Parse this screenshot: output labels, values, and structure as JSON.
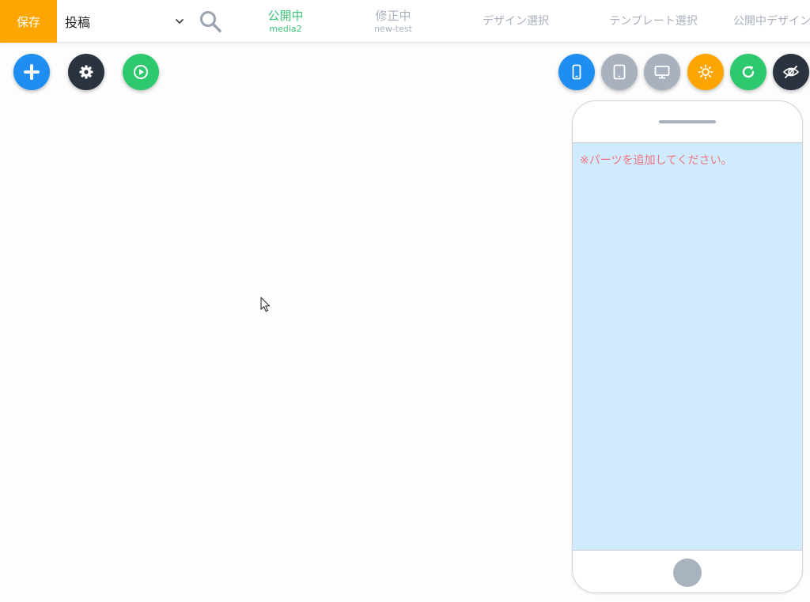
{
  "header": {
    "save_label": "保存",
    "post_type": "投稿",
    "tabs": [
      {
        "label": "公開中",
        "sub": "media2",
        "active": true
      },
      {
        "label": "修正中",
        "sub": "new-test",
        "active": false
      },
      {
        "label": "デザイン選択",
        "sub": "",
        "active": false
      },
      {
        "label": "テンプレート選択",
        "sub": "",
        "active": false
      },
      {
        "label": "公開中デザイン",
        "sub": "",
        "active": false
      }
    ]
  },
  "toolbar_left": [
    {
      "icon": "plus-icon",
      "color": "#1e8ff0"
    },
    {
      "icon": "gear-icon",
      "color": "#2b3240"
    },
    {
      "icon": "play-icon",
      "color": "#2ec86e"
    }
  ],
  "toolbar_right": [
    {
      "icon": "smartphone-icon",
      "color": "#1e8ff0"
    },
    {
      "icon": "tablet-icon",
      "color": "#a8b1bd"
    },
    {
      "icon": "desktop-icon",
      "color": "#a8b1bd"
    },
    {
      "icon": "sun-icon",
      "color": "#ffa500"
    },
    {
      "icon": "refresh-icon",
      "color": "#2ec86e"
    },
    {
      "icon": "eye-off-icon",
      "color": "#2b3240"
    }
  ],
  "preview": {
    "notice": "※パーツを追加してください。"
  },
  "colors": {
    "accent": "#ffa500",
    "active_tab": "#3cc37a",
    "notice": "#f2737f",
    "screen_bg": "#d0ebfd"
  }
}
